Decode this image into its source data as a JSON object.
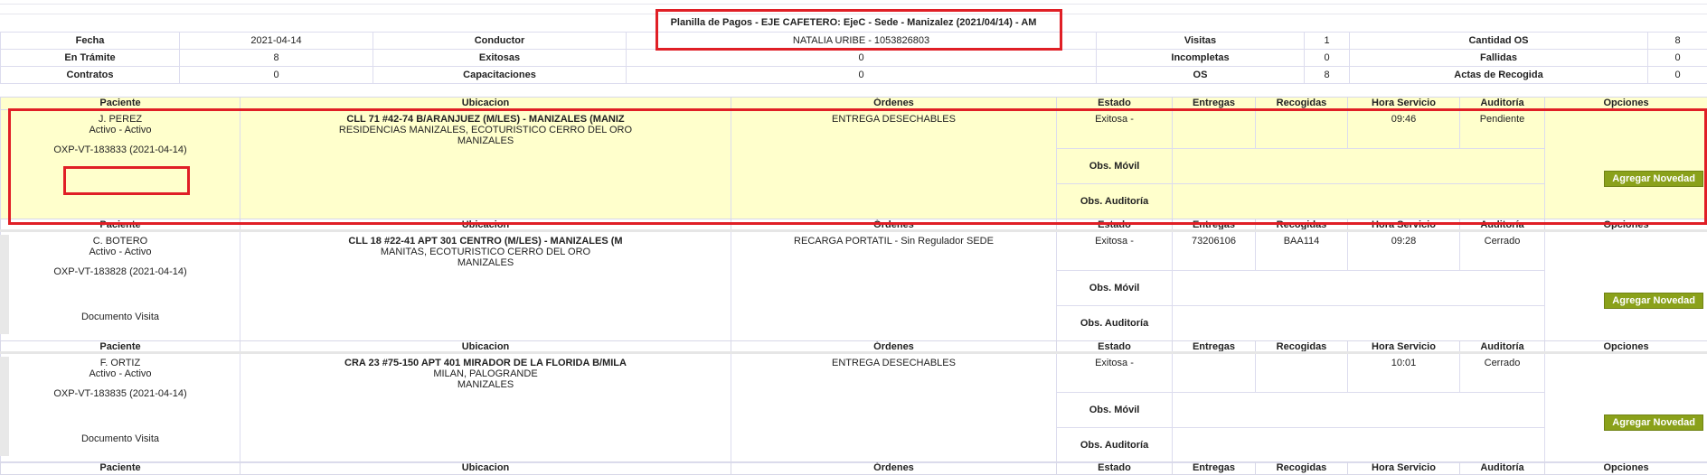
{
  "title": "Planilla de Pagos - EJE CAFETERO: EjeC - Sede - Manizalez (2021/04/14) - AM",
  "summary": {
    "fecha_label": "Fecha",
    "fecha": "2021-04-14",
    "conductor_label": "Conductor",
    "conductor": "NATALIA URIBE - 1053826803",
    "visitas_label": "Visitas",
    "visitas": "1",
    "cantidad_os_label": "Cantidad OS",
    "cantidad_os": "8",
    "en_tramite_label": "En Trámite",
    "en_tramite": "8",
    "exitosas_label": "Exitosas",
    "exitosas": "0",
    "incompletas_label": "Incompletas",
    "incompletas": "0",
    "fallidas_label": "Fallidas",
    "fallidas": "0",
    "contratos_label": "Contratos",
    "contratos": "0",
    "capacitaciones_label": "Capacitaciones",
    "capacitaciones": "0",
    "os_label": "OS",
    "os": "8",
    "actas_label": "Actas de Recogida",
    "actas": "0"
  },
  "headers": {
    "paciente": "Paciente",
    "ubicacion": "Ubicacion",
    "ordenes": "Órdenes",
    "estado": "Estado",
    "entregas": "Entregas",
    "recogidas": "Recogidas",
    "hora": "Hora Servicio",
    "auditoria": "Auditoría",
    "opciones": "Opciones"
  },
  "obs_movil_label": "Obs. Móvil",
  "obs_auditoria_label": "Obs. Auditoría",
  "visits": [
    {
      "patient": "J. PEREZ",
      "status": "Activo - Activo",
      "code": "OXP-VT-183833 (2021-04-14)",
      "doc": "",
      "address": "CLL 71 #42-74 B/ARANJUEZ (M/LES) - MANIZALES (MANIZ",
      "area": "RESIDENCIAS MANIZALES, ECOTURISTICO CERRO DEL ORO",
      "city": "MANIZALES",
      "order": "ENTREGA DESECHABLES",
      "estado": "Exitosa -",
      "entregas": "",
      "recogidas": "",
      "hora": "09:46",
      "auditoria": "Pendiente",
      "button": "Agregar Novedad"
    },
    {
      "patient": "C. BOTERO",
      "status": "Activo - Activo",
      "code": "OXP-VT-183828 (2021-04-14)",
      "doc": "Documento Visita",
      "address": "CLL 18 #22-41 APT 301 CENTRO (M/LES) - MANIZALES (M",
      "area": "MANITAS, ECOTURISTICO CERRO DEL ORO",
      "city": "MANIZALES",
      "order": "RECARGA PORTATIL - Sin Regulador SEDE",
      "estado": "Exitosa -",
      "entregas": "73206106",
      "recogidas": "BAA114",
      "hora": "09:28",
      "auditoria": "Cerrado",
      "button": "Agregar Novedad"
    },
    {
      "patient": "F. ORTIZ",
      "status": "Activo - Activo",
      "code": "OXP-VT-183835 (2021-04-14)",
      "doc": "Documento Visita",
      "address": "CRA 23 #75-150 APT 401 MIRADOR DE LA FLORIDA B/MILA",
      "area": "MILAN, PALOGRANDE",
      "city": "MANIZALES",
      "order": "ENTREGA DESECHABLES",
      "estado": "Exitosa -",
      "entregas": "",
      "recogidas": "",
      "hora": "10:01",
      "auditoria": "Cerrado",
      "button": "Agregar Novedad"
    }
  ]
}
